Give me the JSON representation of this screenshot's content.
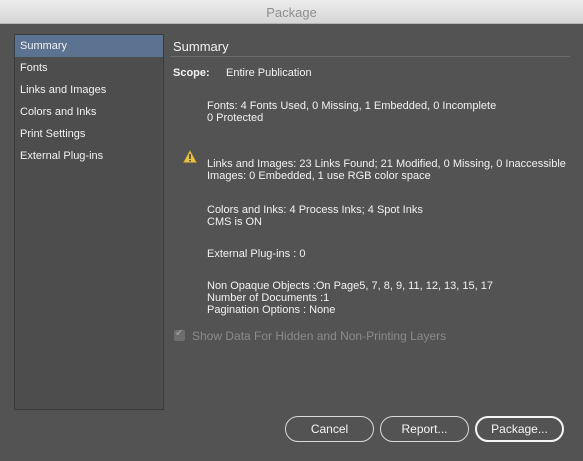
{
  "window": {
    "title": "Package"
  },
  "sidebar": {
    "items": [
      {
        "label": "Summary",
        "selected": true
      },
      {
        "label": "Fonts"
      },
      {
        "label": "Links and Images"
      },
      {
        "label": "Colors and Inks"
      },
      {
        "label": "Print Settings"
      },
      {
        "label": "External Plug-ins"
      }
    ]
  },
  "summary": {
    "title": "Summary",
    "scope_label": "Scope:",
    "scope_value": "Entire Publication",
    "fonts_line1": "Fonts: 4 Fonts Used, 0 Missing, 1 Embedded, 0 Incomplete",
    "fonts_line2": "0 Protected",
    "links_line1": "Links and Images: 23 Links Found; 21 Modified, 0 Missing, 0 Inaccessible",
    "links_line2": "Images: 0 Embedded, 1 use RGB color space",
    "colors_line1": "Colors and Inks: 4 Process Inks; 4 Spot Inks",
    "colors_line2": "CMS is ON",
    "plugins_line": "External Plug-ins : 0",
    "nonopaque_line": "Non Opaque Objects :On Page5, 7, 8, 9, 11, 12, 13, 15, 17",
    "documents_line": "Number of Documents :1",
    "pagination_line": "Pagination Options : None"
  },
  "options": {
    "show_hidden_label": "Show Data For Hidden and Non-Printing Layers",
    "show_hidden_checked": true
  },
  "buttons": {
    "cancel": "Cancel",
    "report": "Report...",
    "package": "Package..."
  },
  "icons": {
    "warning": "warning-triangle-icon",
    "checkmark": "checkmark-icon"
  },
  "colors": {
    "background": "#535353",
    "selection": "#5b7290",
    "warning": "#e8c34a"
  }
}
